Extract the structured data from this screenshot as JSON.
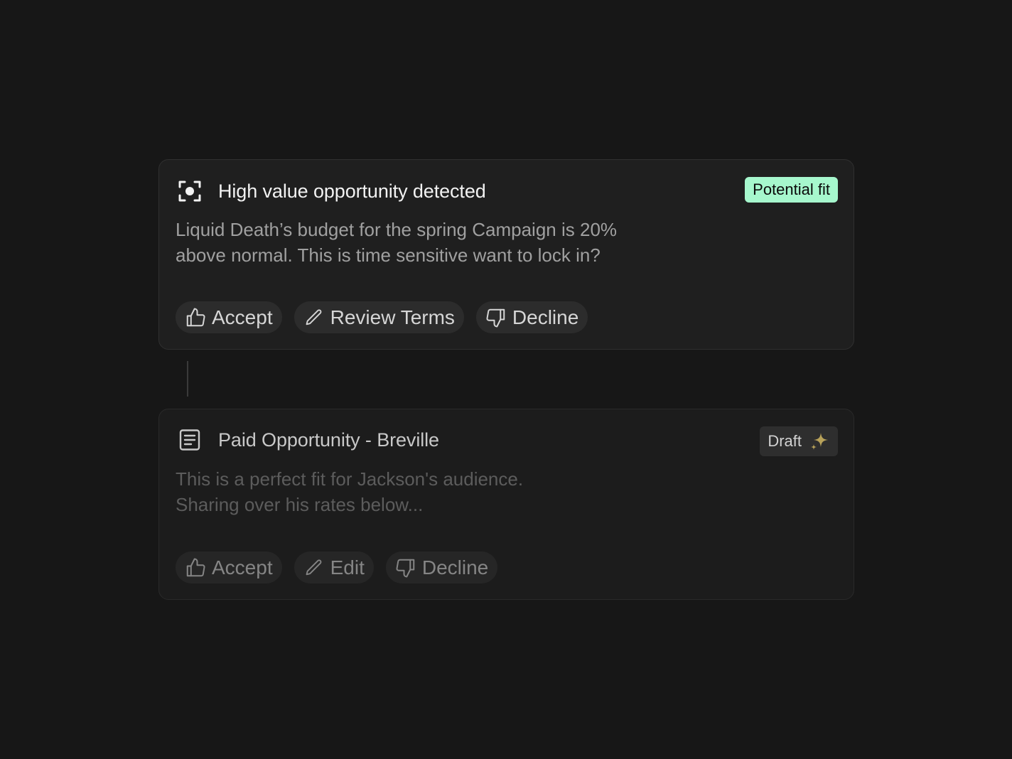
{
  "cards": [
    {
      "title": "High value opportunity detected",
      "icon": "focus-scan-icon",
      "badge": "Potential fit",
      "body_lines": [
        "Liquid Death’s budget for the spring Campaign is 20%",
        "above normal. This is time sensitive want to lock in?"
      ],
      "actions": [
        {
          "label": "Accept",
          "icon": "thumbs-up-icon"
        },
        {
          "label": "Review Terms",
          "icon": "pencil-icon"
        },
        {
          "label": "Decline",
          "icon": "thumbs-down-icon"
        }
      ]
    },
    {
      "title": "Paid Opportunity - Breville",
      "icon": "document-icon",
      "badge": "Draft",
      "badge_icon": "sparkle-icon",
      "body_lines": [
        "This is a perfect fit for Jackson's audience.",
        "Sharing over his rates below..."
      ],
      "actions": [
        {
          "label": "Accept",
          "icon": "thumbs-up-icon"
        },
        {
          "label": "Edit",
          "icon": "pencil-icon"
        },
        {
          "label": "Decline",
          "icon": "thumbs-down-icon"
        }
      ]
    }
  ],
  "colors": {
    "background": "#171717",
    "card": "#1f1f1f",
    "badge_potential": "#a6f7cd",
    "sparkle": "#b8a25a"
  }
}
